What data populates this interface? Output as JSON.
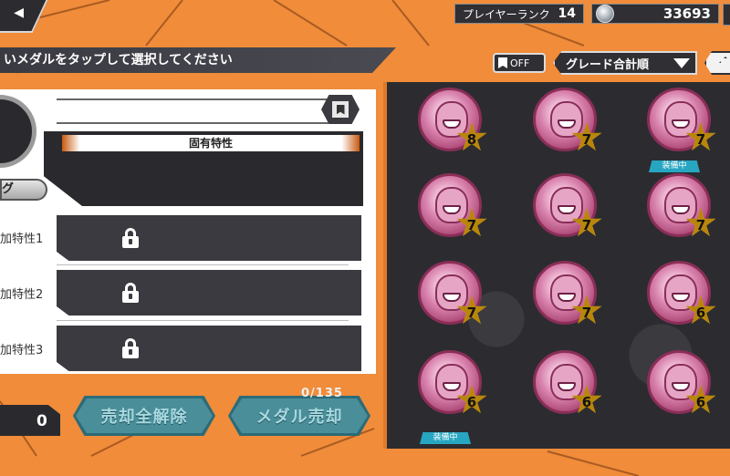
{
  "header": {
    "player_rank_label": "プレイヤーランク",
    "player_rank_value": "14",
    "coins": "33693",
    "instruction": "いメダルをタップして選択してください"
  },
  "toolbar": {
    "favorite_filter_label": "OFF",
    "sort_label": "グレード合計順"
  },
  "detail": {
    "innate_trait_header": "固有特性",
    "tag_button_label": "グ",
    "extra_traits": [
      {
        "label": "加特性1"
      },
      {
        "label": "加特性2"
      },
      {
        "label": "加特性3"
      }
    ]
  },
  "footer": {
    "selected_count": "0",
    "clear_all_label": "売却全解除",
    "sell_label": "メダル売却",
    "capacity": "0/135"
  },
  "medals": [
    {
      "grade": "8",
      "equipped": false
    },
    {
      "grade": "7",
      "equipped": false
    },
    {
      "grade": "7",
      "equipped": false
    },
    {
      "grade": "7",
      "equipped": false
    },
    {
      "grade": "7",
      "equipped": false
    },
    {
      "grade": "7",
      "equipped": true
    },
    {
      "grade": "7",
      "equipped": false
    },
    {
      "grade": "7",
      "equipped": false
    },
    {
      "grade": "6",
      "equipped": false
    },
    {
      "grade": "6",
      "equipped": false
    },
    {
      "grade": "6",
      "equipped": false
    },
    {
      "grade": "6",
      "equipped": false
    }
  ],
  "equipped_badge_label": "装備中",
  "colors": {
    "background_orange": "#f08c3a",
    "panel_dark": "#2c2c30",
    "equip_badge": "#27a6c2",
    "star_gold": "#f4c32a",
    "button_teal": "#4a8e99"
  }
}
